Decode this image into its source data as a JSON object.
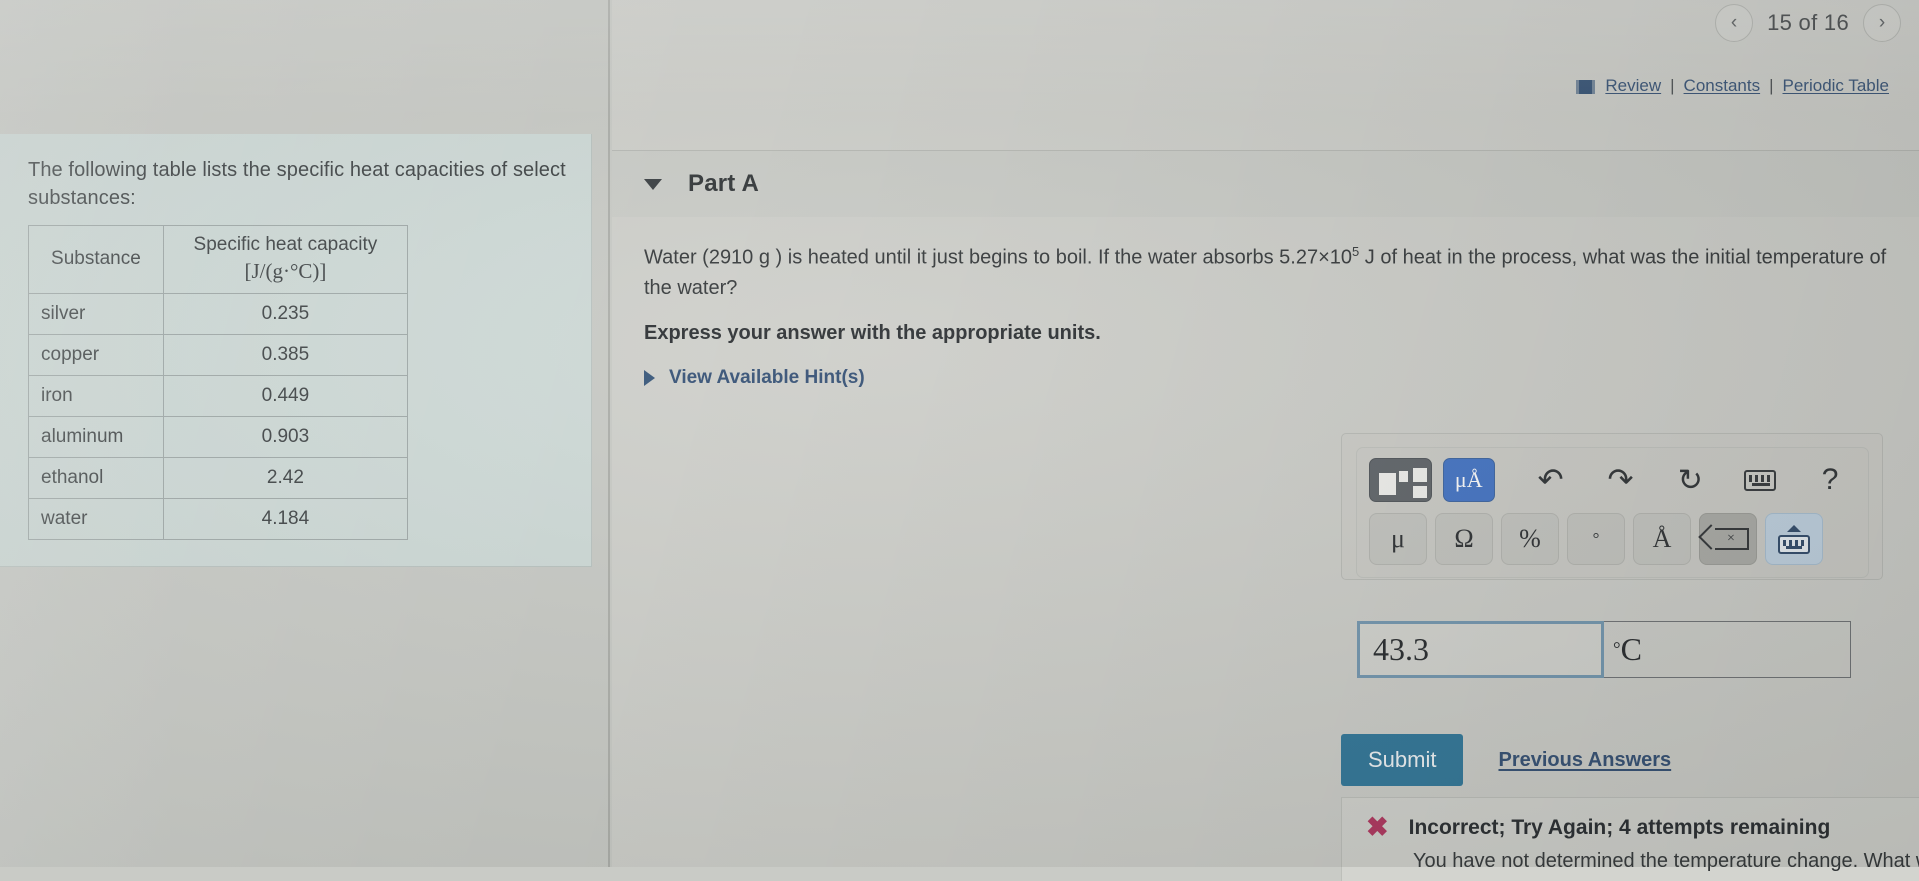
{
  "pagination": {
    "prev_icon": "chevron-left-icon",
    "next_icon": "chevron-right-icon",
    "prev_label": "‹",
    "next_label": "›",
    "indicator": "15 of 16"
  },
  "top_links": {
    "book_icon": "book-icon",
    "review": "Review",
    "separator": "|",
    "constants": "Constants",
    "periodic_table": "Periodic Table"
  },
  "reference": {
    "intro": "The following table lists the specific heat capacities of select substances:",
    "table": {
      "headers": {
        "substance": "Substance",
        "capacity_title": "Specific heat capacity",
        "capacity_units": "[J/(g·°C)]"
      },
      "rows": [
        {
          "substance": "silver",
          "value": "0.235"
        },
        {
          "substance": "copper",
          "value": "0.385"
        },
        {
          "substance": "iron",
          "value": "0.449"
        },
        {
          "substance": "aluminum",
          "value": "0.903"
        },
        {
          "substance": "ethanol",
          "value": "2.42"
        },
        {
          "substance": "water",
          "value": "4.184"
        }
      ]
    }
  },
  "part": {
    "caret_icon": "caret-down-icon",
    "title": "Part A",
    "question_pre": "Water (2910 g ) is heated until it just begins to boil. If the water absorbs 5.27×10",
    "question_exp": "5",
    "question_post": " J of heat in the process, what was the initial temperature of the water?",
    "express_instruction": "Express your answer with the appropriate units.",
    "hints_caret_icon": "caret-right-icon",
    "hints_label": "View Available Hint(s)"
  },
  "toolbar": {
    "template_button": "template-icon",
    "mua_button": "μÅ",
    "undo_button": "↶",
    "redo_button": "↷",
    "refresh_button": "↻",
    "keyboard_button": "keyboard-icon",
    "help_button": "?",
    "keys": [
      {
        "name": "mu-key",
        "label": "μ"
      },
      {
        "name": "omega-key",
        "label": "Ω"
      },
      {
        "name": "percent-key",
        "label": "%"
      },
      {
        "name": "degree-key",
        "label": "°"
      },
      {
        "name": "angstrom-key",
        "label": "Å"
      }
    ],
    "backspace_key": "×",
    "hide_keyboard_key": "hide-keyboard-icon"
  },
  "answer": {
    "value": "43.3",
    "units_prefix": "°",
    "units_main": "C",
    "placeholder": ""
  },
  "actions": {
    "submit_label": "Submit",
    "previous_answers_label": "Previous Answers"
  },
  "feedback": {
    "icon": "x-mark-icon",
    "icon_glyph": "✖",
    "title": "Incorrect; Try Again; 4 attempts remaining",
    "detail": "You have not determined the temperature change. What was the initial temperature of the water?"
  },
  "colors": {
    "accent_blue": "#2d4a70",
    "submit_blue": "#2a7397",
    "active_key_blue": "#3d6fc4",
    "error_red": "#b0305a",
    "reference_panel": "#ccd8d5"
  }
}
